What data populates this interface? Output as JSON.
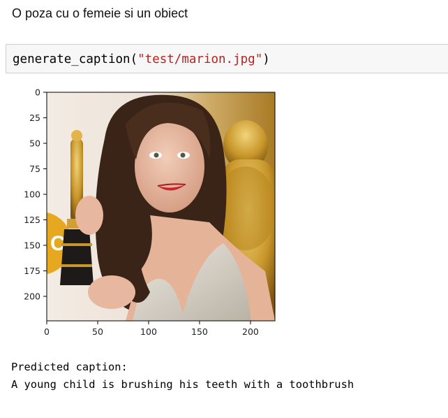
{
  "markdown": {
    "text": "O poza cu o femeie si un obiect"
  },
  "code_cell": {
    "func": "generate_caption",
    "open_paren": "(",
    "arg": "\"test/marion.jpg\"",
    "close_paren": ")"
  },
  "figure": {
    "image_description_icon": "photo-woman-holding-trophy",
    "x_ticks": [
      "0",
      "50",
      "100",
      "150",
      "200"
    ],
    "y_ticks": [
      "0",
      "25",
      "50",
      "75",
      "100",
      "125",
      "150",
      "175",
      "200"
    ],
    "x_range": [
      0,
      224
    ],
    "y_range": [
      0,
      224
    ],
    "colors": {
      "background_wall": "#e9d7c4",
      "gold": "#c8962a",
      "hair": "#3a2418",
      "skin": "#e7b79f",
      "dress": "#d8d3c9"
    }
  },
  "output": {
    "line1": "Predicted caption:",
    "line2": "A young child is brushing his teeth with a toothbrush"
  }
}
